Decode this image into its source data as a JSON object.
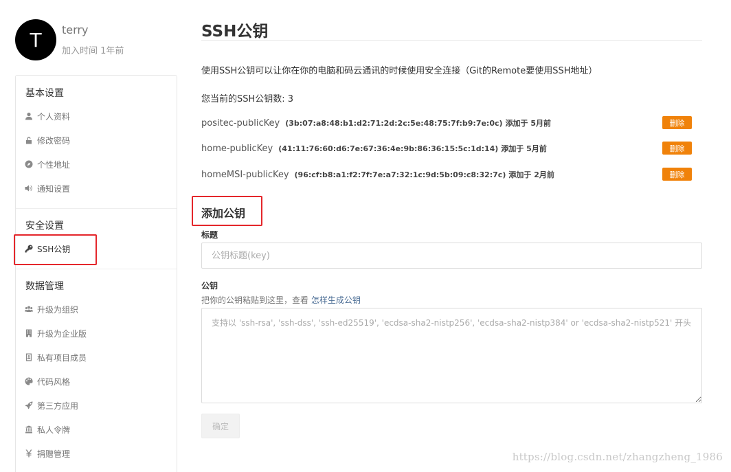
{
  "user": {
    "avatar_letter": "T",
    "name": "terry",
    "joined": "加入时间 1年前"
  },
  "sidebar": {
    "groups": [
      {
        "title": "基本设置",
        "items": [
          {
            "label": "个人资料",
            "icon": "user-icon"
          },
          {
            "label": "修改密码",
            "icon": "lock-icon"
          },
          {
            "label": "个性地址",
            "icon": "compass-icon"
          },
          {
            "label": "通知设置",
            "icon": "speaker-icon"
          }
        ]
      },
      {
        "title": "安全设置",
        "items": [
          {
            "label": "SSH公钥",
            "icon": "key-icon",
            "active": true
          }
        ]
      },
      {
        "title": "数据管理",
        "items": [
          {
            "label": "升级为组织",
            "icon": "group-icon"
          },
          {
            "label": "升级为企业版",
            "icon": "building-icon"
          },
          {
            "label": "私有项目成员",
            "icon": "member-card-icon"
          },
          {
            "label": "代码风格",
            "icon": "palette-icon"
          },
          {
            "label": "第三方应用",
            "icon": "rocket-icon"
          },
          {
            "label": "私人令牌",
            "icon": "token-icon"
          },
          {
            "label": "捐赠管理",
            "icon": "yen-icon"
          }
        ]
      }
    ]
  },
  "main": {
    "title": "SSH公钥",
    "description": "使用SSH公钥可以让你在你的电脑和码云通讯的时候使用安全连接（Git的Remote要使用SSH地址）",
    "count_text": "您当前的SSH公钥数: 3",
    "keys": [
      {
        "name": "positec-publicKey",
        "fingerprint": "(3b:07:a8:48:b1:d2:71:2d:2c:5e:48:75:7f:b9:7e:0c)",
        "added": "添加于 5月前",
        "delete_label": "删除"
      },
      {
        "name": "home-publicKey",
        "fingerprint": "(41:11:76:60:d6:7e:67:36:4e:9b:86:36:15:5c:1d:14)",
        "added": "添加于 5月前",
        "delete_label": "删除"
      },
      {
        "name": "homeMSI-publicKey",
        "fingerprint": "(96:cf:b8:a1:f2:7f:7e:a7:32:1c:9d:5b:09:c8:32:7c)",
        "added": "添加于 2月前",
        "delete_label": "删除"
      }
    ],
    "add_section_title": "添加公钥",
    "title_field": {
      "label": "标题",
      "placeholder": "公钥标题(key)",
      "value": ""
    },
    "key_field": {
      "label": "公钥",
      "hint_prefix": "把你的公钥粘贴到这里，查看",
      "hint_link": "怎样生成公钥",
      "placeholder": "支持以 'ssh-rsa', 'ssh-dss', 'ssh-ed25519', 'ecdsa-sha2-nistp256', 'ecdsa-sha2-nistp384' or 'ecdsa-sha2-nistp521' 开头",
      "value": ""
    },
    "submit_label": "确定"
  },
  "watermark": "https://blog.csdn.net/zhangzheng_1986",
  "colors": {
    "highlight": "#e4262b",
    "delete_button": "#f0820a",
    "link": "#4a6c94"
  }
}
